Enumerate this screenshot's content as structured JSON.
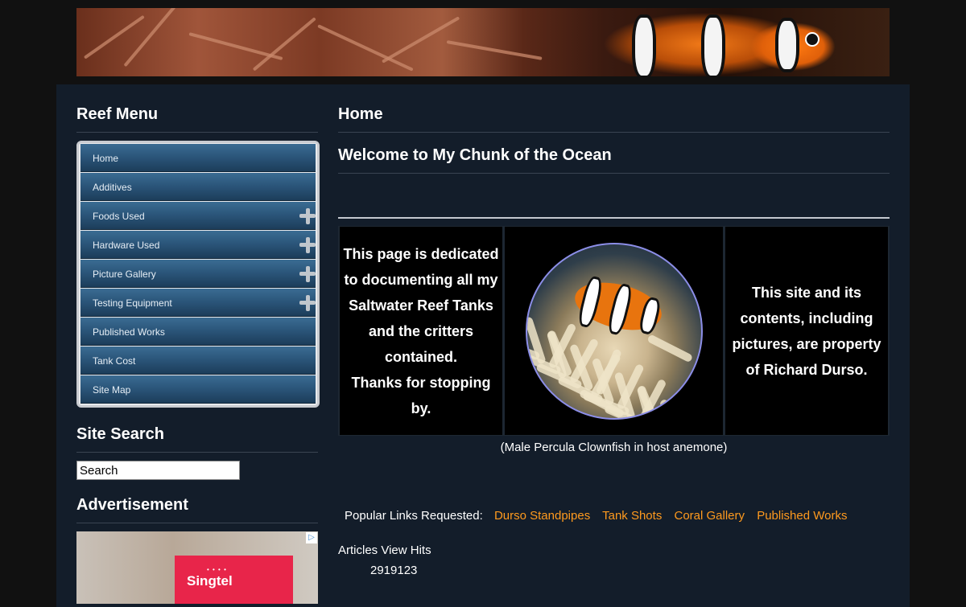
{
  "sidebar": {
    "menu_title": "Reef Menu",
    "menu": [
      {
        "label": "Home",
        "expandable": false
      },
      {
        "label": "Additives",
        "expandable": false
      },
      {
        "label": "Foods Used",
        "expandable": true
      },
      {
        "label": "Hardware Used",
        "expandable": true
      },
      {
        "label": "Picture Gallery",
        "expandable": true
      },
      {
        "label": "Testing Equipment",
        "expandable": true
      },
      {
        "label": "Published Works",
        "expandable": false
      },
      {
        "label": "Tank Cost",
        "expandable": false
      },
      {
        "label": "Site Map",
        "expandable": false
      }
    ],
    "search_title": "Site Search",
    "search_value": "Search",
    "ad_title": "Advertisement",
    "ad_brand": "Singtel"
  },
  "main": {
    "page_title": "Home",
    "article_title": "Welcome to My Chunk of the Ocean",
    "left_text_1": "This page is dedicated to documenting all my Saltwater Reef Tanks and the critters contained.",
    "left_text_2": "Thanks for stopping by.",
    "right_text": "This site and its contents, including pictures, are property of Richard Durso.",
    "caption": "(Male Percula Clownfish in host anemone)",
    "popular_label": "Popular Links Requested:",
    "popular_links": [
      "Durso Standpipes",
      "Tank Shots",
      "Coral Gallery",
      "Published Works"
    ],
    "hits_label": "Articles View Hits",
    "hits_value": "2919123"
  },
  "colors": {
    "background": "#111111",
    "panel": "#131d2a",
    "link": "#ff9a1e",
    "menu_top": "#3b6c93",
    "menu_bottom": "#1c3d5a"
  }
}
